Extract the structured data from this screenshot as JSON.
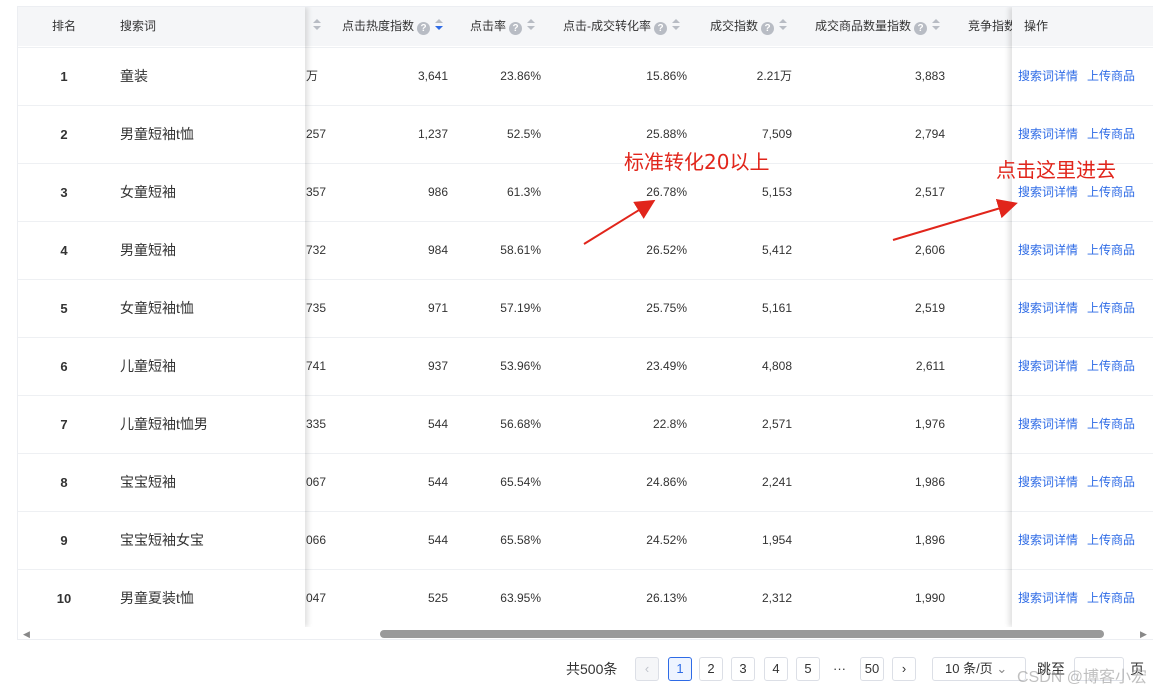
{
  "columns": {
    "rank": "排名",
    "keyword": "搜索词",
    "click_heat": "点击热度指数",
    "ctr": "点击率",
    "click_conv": "点击-成交转化率",
    "deal_index": "成交指数",
    "deal_goods_index": "成交商品数量指数",
    "competition": "竞争指数",
    "action": "操作"
  },
  "rows": [
    {
      "rank": "1",
      "keyword": "童装",
      "search_partial": "万",
      "click_heat": "3,641",
      "ctr": "23.86%",
      "conv": "15.86%",
      "deal": "2.21万",
      "goods": "3,883"
    },
    {
      "rank": "2",
      "keyword": "男童短袖t恤",
      "search_partial": "257",
      "click_heat": "1,237",
      "ctr": "52.5%",
      "conv": "25.88%",
      "deal": "7,509",
      "goods": "2,794"
    },
    {
      "rank": "3",
      "keyword": "女童短袖",
      "search_partial": "357",
      "click_heat": "986",
      "ctr": "61.3%",
      "conv": "26.78%",
      "deal": "5,153",
      "goods": "2,517"
    },
    {
      "rank": "4",
      "keyword": "男童短袖",
      "search_partial": "732",
      "click_heat": "984",
      "ctr": "58.61%",
      "conv": "26.52%",
      "deal": "5,412",
      "goods": "2,606"
    },
    {
      "rank": "5",
      "keyword": "女童短袖t恤",
      "search_partial": "735",
      "click_heat": "971",
      "ctr": "57.19%",
      "conv": "25.75%",
      "deal": "5,161",
      "goods": "2,519"
    },
    {
      "rank": "6",
      "keyword": "儿童短袖",
      "search_partial": "741",
      "click_heat": "937",
      "ctr": "53.96%",
      "conv": "23.49%",
      "deal": "4,808",
      "goods": "2,611"
    },
    {
      "rank": "7",
      "keyword": "儿童短袖t恤男",
      "search_partial": "335",
      "click_heat": "544",
      "ctr": "56.68%",
      "conv": "22.8%",
      "deal": "2,571",
      "goods": "1,976"
    },
    {
      "rank": "8",
      "keyword": "宝宝短袖",
      "search_partial": "067",
      "click_heat": "544",
      "ctr": "65.54%",
      "conv": "24.86%",
      "deal": "2,241",
      "goods": "1,986"
    },
    {
      "rank": "9",
      "keyword": "宝宝短袖女宝",
      "search_partial": "066",
      "click_heat": "544",
      "ctr": "65.58%",
      "conv": "24.52%",
      "deal": "1,954",
      "goods": "1,896"
    },
    {
      "rank": "10",
      "keyword": "男童夏装t恤",
      "search_partial": "047",
      "click_heat": "525",
      "ctr": "63.95%",
      "conv": "26.13%",
      "deal": "2,312",
      "goods": "1,990"
    }
  ],
  "actions": {
    "detail": "搜索词详情",
    "upload": "上传商品"
  },
  "annotations": {
    "left": "标准转化20以上",
    "right": "点击这里进去"
  },
  "pagination": {
    "total": "共500条",
    "pages": [
      "1",
      "2",
      "3",
      "4",
      "5"
    ],
    "ellipsis": "···",
    "last": "50",
    "page_size": "10 条/页",
    "jump_label": "跳至",
    "page_unit": "页"
  },
  "icons": {
    "help": "?",
    "prev": "‹",
    "next": "›",
    "select_arrow": "⌄"
  },
  "watermark": "CSDN @博客小宏",
  "colors": {
    "link": "#2e6be6",
    "annotation": "#e1251b",
    "header_bg": "#f5f6f8"
  }
}
